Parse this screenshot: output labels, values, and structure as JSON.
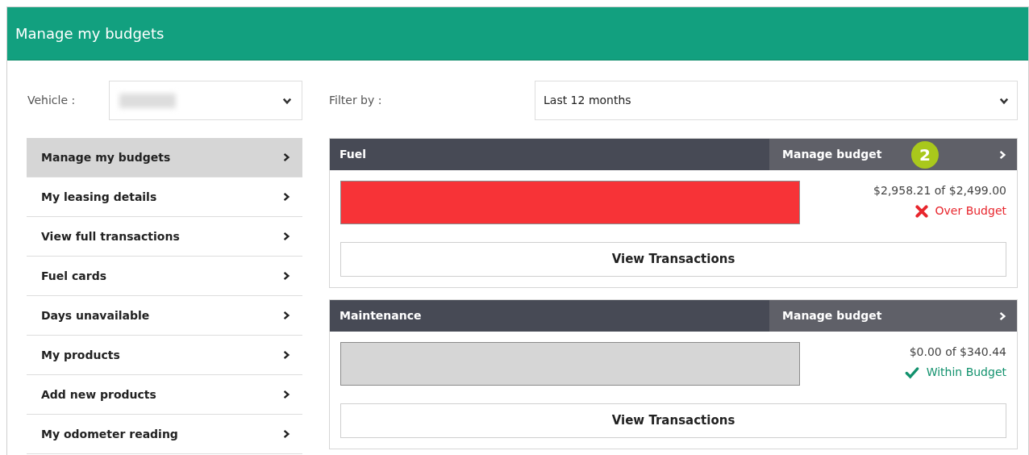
{
  "header": {
    "title": "Manage my budgets"
  },
  "vehicle": {
    "label": "Vehicle :"
  },
  "filter": {
    "label": "Filter by :",
    "value": "Last 12 months"
  },
  "sidebar": {
    "items": [
      {
        "label": "Manage my budgets",
        "selected": true
      },
      {
        "label": "My leasing details",
        "selected": false
      },
      {
        "label": "View full transactions",
        "selected": false
      },
      {
        "label": "Fuel cards",
        "selected": false
      },
      {
        "label": "Days unavailable",
        "selected": false
      },
      {
        "label": "My products",
        "selected": false
      },
      {
        "label": "Add new products",
        "selected": false
      },
      {
        "label": "My odometer reading",
        "selected": false
      }
    ]
  },
  "budgets": [
    {
      "title": "Fuel",
      "action": "Manage budget",
      "badge": "2",
      "level": 1,
      "amount": "$2,958.21 of $2,499.00",
      "status": {
        "kind": "over",
        "label": "Over Budget"
      },
      "button": "View Transactions"
    },
    {
      "title": "Maintenance",
      "action": "Manage budget",
      "level": 0,
      "amount": "$0.00 of $340.44",
      "status": {
        "kind": "within",
        "label": "Within Budget"
      },
      "button": "View Transactions"
    }
  ]
}
